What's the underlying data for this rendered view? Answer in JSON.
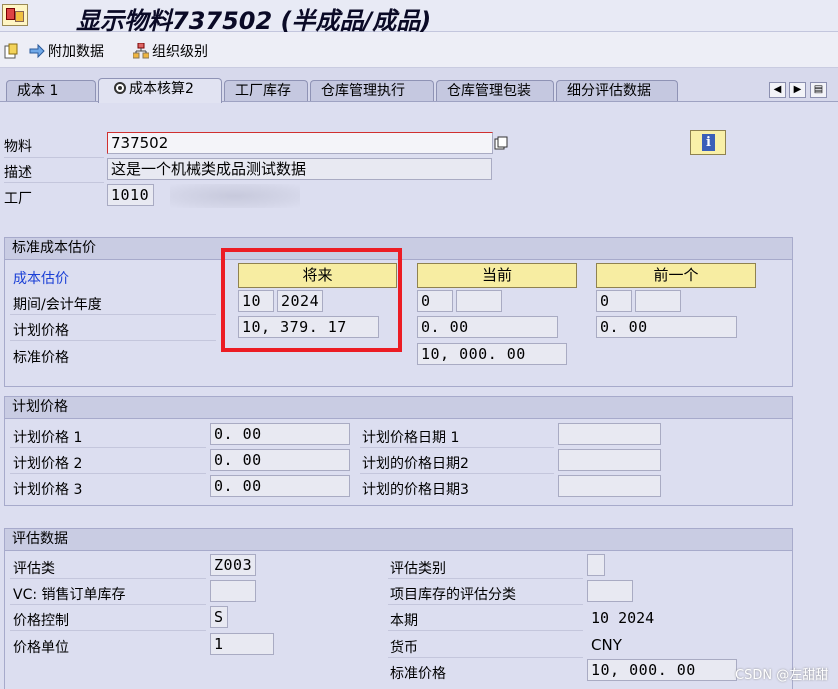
{
  "window": {
    "title": "显示物料737502 (半成品/成品)"
  },
  "toolbar": {
    "additional_data": "附加数据",
    "org_levels": "组织级别"
  },
  "tabs": [
    {
      "label": "成本 1"
    },
    {
      "label": "成本核算2"
    },
    {
      "label": "工厂库存"
    },
    {
      "label": "仓库管理执行"
    },
    {
      "label": "仓库管理包装"
    },
    {
      "label": "细分评估数据"
    }
  ],
  "header": {
    "material_label": "物料",
    "material_value": "737502",
    "desc_label": "描述",
    "desc_value": "这是一个机械类成品测试数据",
    "plant_label": "工厂",
    "plant_value": "1010"
  },
  "std_cost": {
    "title": "标准成本估价",
    "cost_estimate_label": "成本估价",
    "period_label": "期间/会计年度",
    "planned_price_label": "计划价格",
    "standard_price_label": "标准价格",
    "future": {
      "button": "将来",
      "period": "10",
      "year": "2024",
      "planned_price": "10, 379. 17"
    },
    "current": {
      "button": "当前",
      "period": "0",
      "year": "",
      "planned_price": "0. 00",
      "standard_price": "10, 000. 00"
    },
    "previous": {
      "button": "前一个",
      "period": "0",
      "year": "",
      "planned_price": "0. 00"
    }
  },
  "planned_prices": {
    "title": "计划价格",
    "price1_label": "计划价格 1",
    "price1_value": "0. 00",
    "price2_label": "计划价格 2",
    "price2_value": "0. 00",
    "price3_label": "计划价格 3",
    "price3_value": "0. 00",
    "date1_label": "计划价格日期 1",
    "date1_value": "",
    "date2_label": "计划的价格日期2",
    "date2_value": "",
    "date3_label": "计划的价格日期3",
    "date3_value": ""
  },
  "valuation": {
    "title": "评估数据",
    "val_class_label": "评估类",
    "val_class_value": "Z003",
    "vc_label": "VC: 销售订单库存",
    "vc_value": "",
    "price_control_label": "价格控制",
    "price_control_value": "S",
    "price_unit_label": "价格单位",
    "price_unit_value": "1",
    "val_category_label": "评估类别",
    "val_category_value": "",
    "proj_stock_label": "项目库存的评估分类",
    "proj_stock_value": "",
    "current_period_label": "本期",
    "current_period_value": "10  2024",
    "currency_label": "货币",
    "currency_value": "CNY",
    "standard_price_label": "标准价格",
    "standard_price_value": "10, 000. 00"
  },
  "watermark": "CSDN @左甜甜",
  "colors": {
    "highlight": "#ec1c24",
    "button_yellow": "#f7eda2",
    "link_blue": "#1a3fd6"
  },
  "icons": [
    "sap-app-icon",
    "new-doc-icon",
    "arrow-right-icon",
    "org-tree-icon",
    "info-icon",
    "copy-icon",
    "cost-icon"
  ]
}
